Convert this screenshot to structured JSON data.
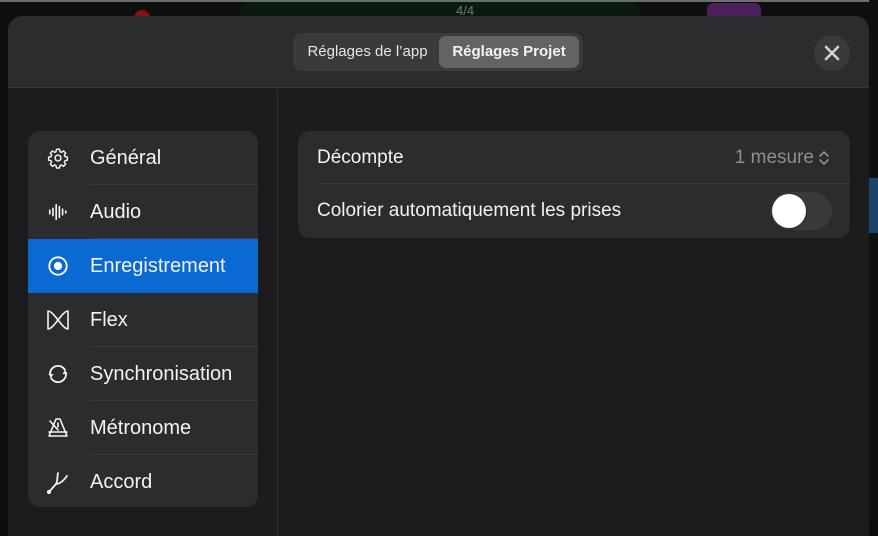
{
  "background": {
    "time_signature": "4/4"
  },
  "header": {
    "tabs": [
      {
        "label": "Réglages de l’app",
        "selected": false
      },
      {
        "label": "Réglages Projet",
        "selected": true
      }
    ],
    "close_icon": "close-icon"
  },
  "sidebar": {
    "items": [
      {
        "label": "Général",
        "icon": "gear-icon",
        "selected": false
      },
      {
        "label": "Audio",
        "icon": "waveform-icon",
        "selected": false
      },
      {
        "label": "Enregistrement",
        "icon": "record-icon",
        "selected": true
      },
      {
        "label": "Flex",
        "icon": "flex-icon",
        "selected": false
      },
      {
        "label": "Synchronisation",
        "icon": "sync-icon",
        "selected": false
      },
      {
        "label": "Métronome",
        "icon": "metronome-icon",
        "selected": false
      },
      {
        "label": "Accord",
        "icon": "tuning-fork-icon",
        "selected": false
      }
    ]
  },
  "settings": {
    "count_in": {
      "label": "Décompte",
      "value": "1 mesure",
      "icon": "chevron-up-down-icon"
    },
    "auto_color_takes": {
      "label": "Colorier automatiquement les prises",
      "enabled": false
    }
  },
  "colors": {
    "accent": "#0a69d2",
    "panel": "#2c2c2e",
    "modal_bg": "#1c1c1e"
  }
}
